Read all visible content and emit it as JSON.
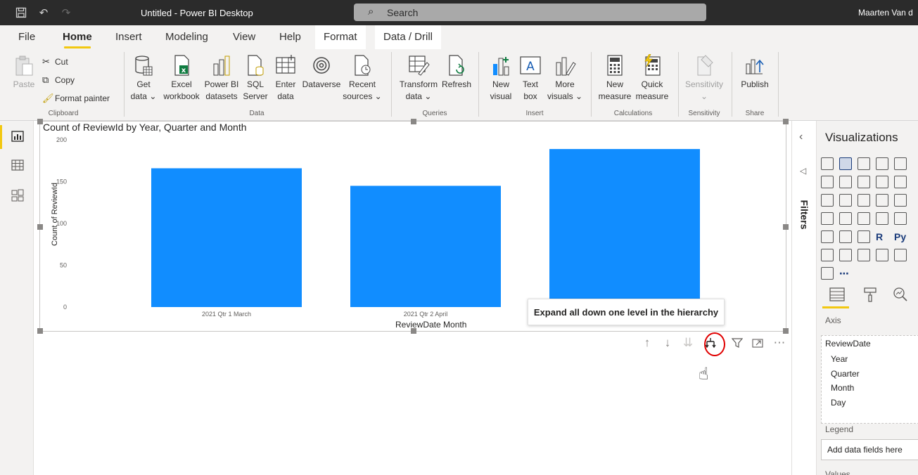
{
  "titlebar": {
    "app_title": "Untitled - Power BI Desktop",
    "search_placeholder": "Search",
    "user_name": "Maarten Van d"
  },
  "tabs": [
    "File",
    "Home",
    "Insert",
    "Modeling",
    "View",
    "Help",
    "Format",
    "Data / Drill"
  ],
  "active_tab": "Home",
  "ribbon": {
    "clipboard": {
      "paste": "Paste",
      "cut": "Cut",
      "copy": "Copy",
      "format_painter": "Format painter",
      "group": "Clipboard"
    },
    "data": {
      "get_data": [
        "Get",
        "data ⌄"
      ],
      "excel": [
        "Excel",
        "workbook"
      ],
      "pbi_datasets": [
        "Power BI",
        "datasets"
      ],
      "sql": [
        "SQL",
        "Server"
      ],
      "enter_data": [
        "Enter",
        "data"
      ],
      "dataverse": [
        "Dataverse",
        ""
      ],
      "recent": [
        "Recent",
        "sources ⌄"
      ],
      "group": "Data"
    },
    "queries": {
      "transform": [
        "Transform",
        "data ⌄"
      ],
      "refresh": [
        "Refresh",
        ""
      ],
      "group": "Queries"
    },
    "insert": {
      "new_visual": [
        "New",
        "visual"
      ],
      "text_box": [
        "Text",
        "box"
      ],
      "more_visuals": [
        "More",
        "visuals ⌄"
      ],
      "group": "Insert"
    },
    "calculations": {
      "new_measure": [
        "New",
        "measure"
      ],
      "quick_measure": [
        "Quick",
        "measure"
      ],
      "group": "Calculations"
    },
    "sensitivity": {
      "label": [
        "Sensitivity",
        "⌄"
      ],
      "group": "Sensitivity"
    },
    "share": {
      "publish": [
        "Publish",
        ""
      ],
      "group": "Share"
    }
  },
  "chart_data": {
    "type": "bar",
    "title": "Count of ReviewId by Year, Quarter and Month",
    "xlabel": "ReviewDate Month",
    "ylabel": "Count of ReviewId",
    "categories": [
      "2021 Qtr 1 March",
      "2021 Qtr 2 April",
      ""
    ],
    "values": [
      166,
      145,
      189
    ],
    "ylim": [
      0,
      200
    ],
    "yticks": [
      0,
      50,
      100,
      150,
      200
    ],
    "bar_color": "#118dff",
    "grid": false
  },
  "tooltip": "Expand all down one level in the hierarchy",
  "filters_label": "Filters",
  "viz_pane": {
    "title": "Visualizations",
    "axis_label": "Axis",
    "axis_field": "ReviewDate",
    "axis_items": [
      "Year",
      "Quarter",
      "Month",
      "Day"
    ],
    "legend_label": "Legend",
    "legend_placeholder": "Add data fields here",
    "values_label": "Values"
  },
  "colors": {
    "accent": "#f2c811",
    "titlebar": "#2b2b2b",
    "annotation": "#e00000"
  }
}
